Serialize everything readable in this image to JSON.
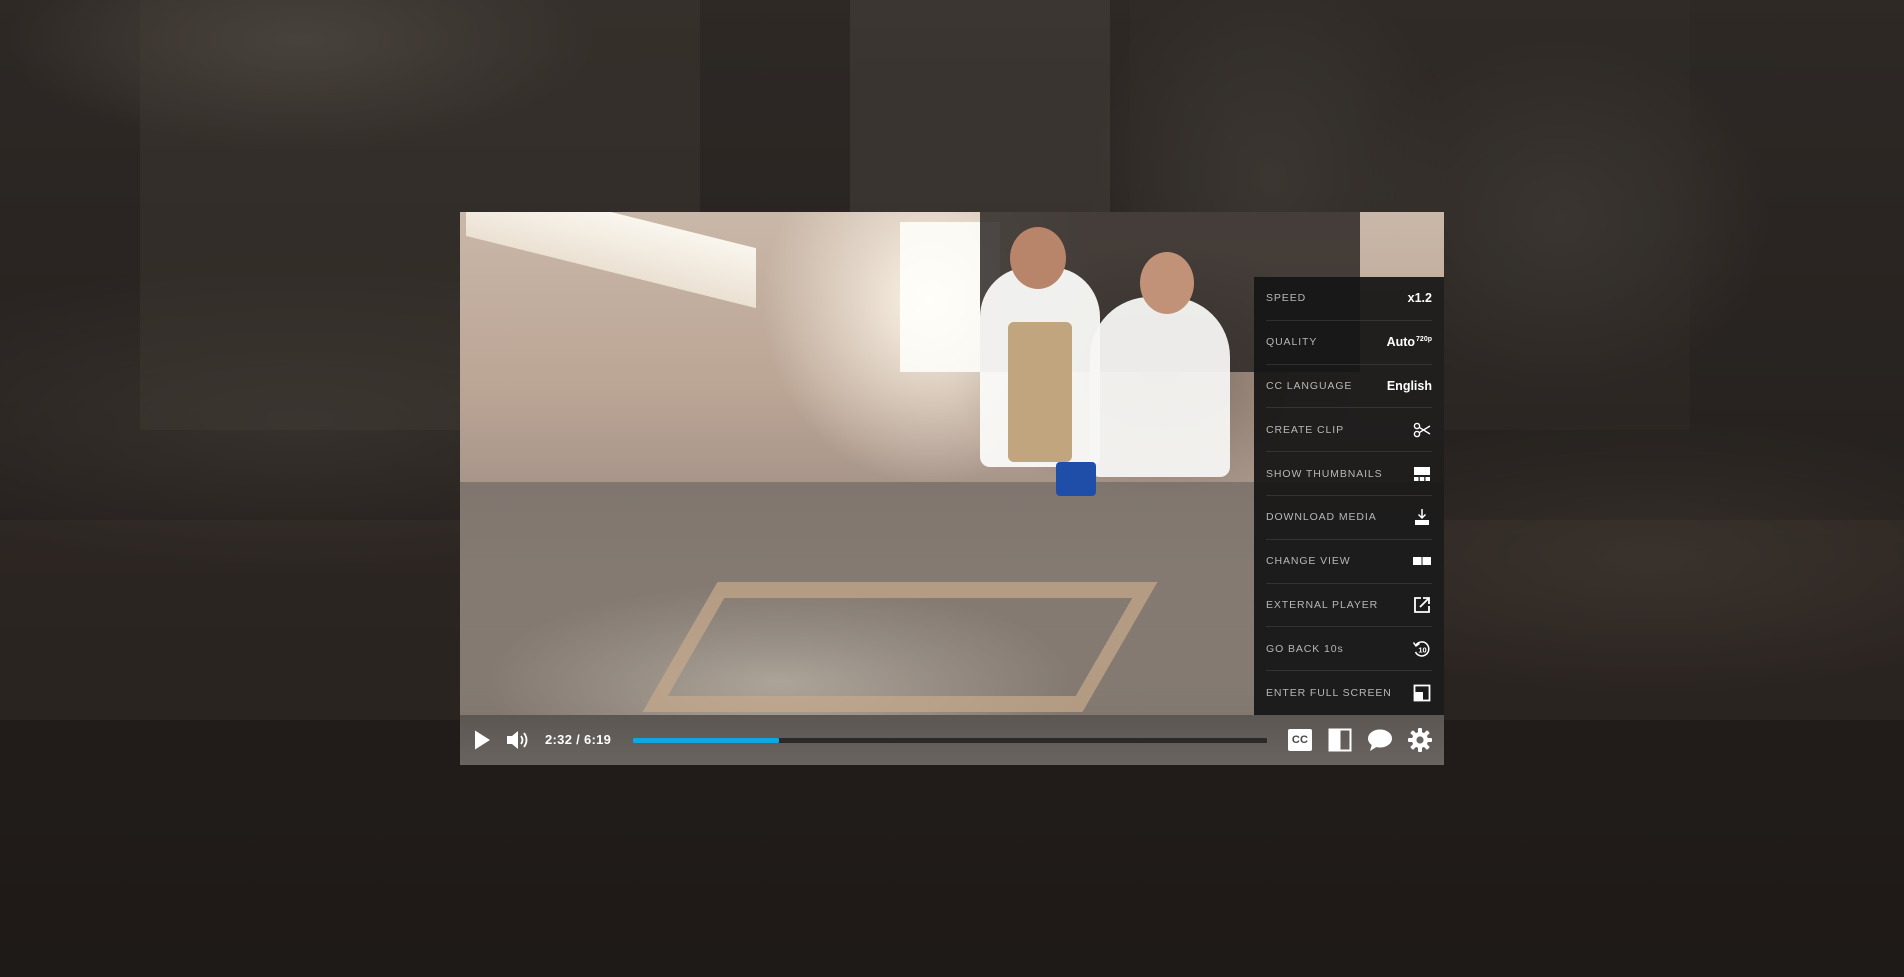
{
  "player": {
    "time_display": "2:32 / 6:19",
    "progress_fraction": 0.23,
    "accent_color": "#10a7e0"
  },
  "controls": {
    "left": [
      {
        "name": "play-icon",
        "icon": "play"
      },
      {
        "name": "volume-icon",
        "icon": "volume"
      }
    ],
    "right": [
      {
        "name": "cc-icon",
        "icon": "closed-captions",
        "text": "CC"
      },
      {
        "name": "sidebar-toggle-icon",
        "icon": "sidebar"
      },
      {
        "name": "chat-icon",
        "icon": "speech-bubble"
      },
      {
        "name": "settings-gear-icon",
        "icon": "gear"
      }
    ]
  },
  "settings_menu": {
    "items": [
      {
        "label": "SPEED",
        "value": "x1.2"
      },
      {
        "label": "QUALITY",
        "value": "Auto",
        "value_sup": "720p"
      },
      {
        "label": "CC LANGUAGE",
        "value": "English"
      },
      {
        "label": "CREATE CLIP",
        "icon": "scissors-icon"
      },
      {
        "label": "SHOW THUMBNAILS",
        "icon": "thumbnails-icon"
      },
      {
        "label": "DOWNLOAD MEDIA",
        "icon": "download-icon"
      },
      {
        "label": "CHANGE VIEW",
        "icon": "split-view-icon"
      },
      {
        "label": "EXTERNAL PLAYER",
        "icon": "external-link-icon"
      },
      {
        "label": "GO BACK 10s",
        "icon": "rewind-10-icon"
      },
      {
        "label": "ENTER FULL SCREEN",
        "icon": "fullscreen-icon"
      }
    ]
  }
}
